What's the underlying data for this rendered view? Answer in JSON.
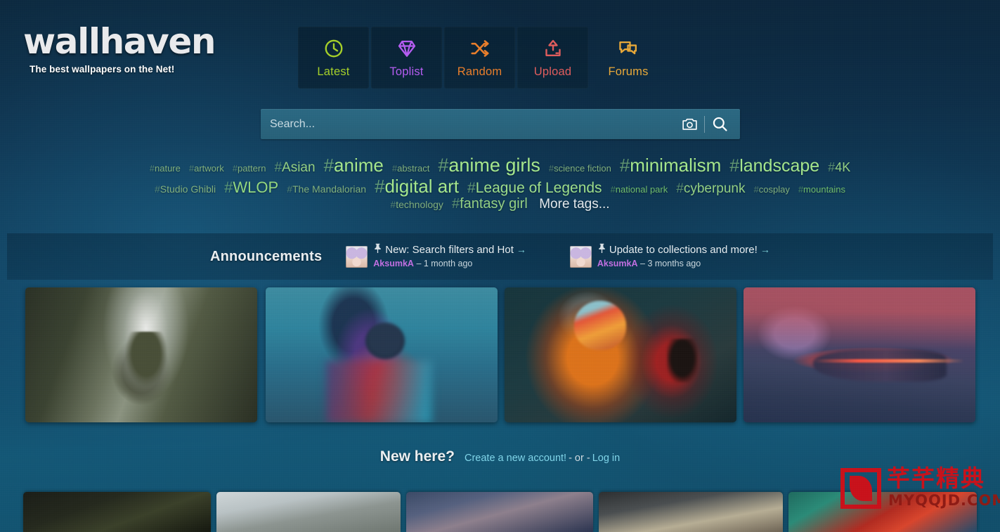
{
  "site": {
    "logo": "wallhaven",
    "tagline": "The best wallpapers on the Net!"
  },
  "nav": {
    "items": [
      {
        "label": "Latest",
        "icon": "clock-icon",
        "color": "#a5d028",
        "boxed": true
      },
      {
        "label": "Toplist",
        "icon": "diamond-icon",
        "color": "#b45cf0",
        "boxed": true
      },
      {
        "label": "Random",
        "icon": "shuffle-icon",
        "color": "#e87d2a",
        "boxed": true
      },
      {
        "label": "Upload",
        "icon": "upload-icon",
        "color": "#e05c5c",
        "boxed": true
      },
      {
        "label": "Forums",
        "icon": "chat-icon",
        "color": "#e8a838",
        "boxed": false
      }
    ]
  },
  "search": {
    "value": "",
    "placeholder": "Search...",
    "camera_icon": "camera-icon",
    "submit_icon": "magnifier-icon"
  },
  "tags": {
    "rows": [
      [
        {
          "label": "nature",
          "size": 13,
          "color": "#7fae7d"
        },
        {
          "label": "artwork",
          "size": 13,
          "color": "#7fae7d"
        },
        {
          "label": "pattern",
          "size": 13,
          "color": "#7fae7d"
        },
        {
          "label": "Asian",
          "size": 19,
          "color": "#93cf83"
        },
        {
          "label": "anime",
          "size": 26,
          "color": "#a4e68c"
        },
        {
          "label": "abstract",
          "size": 13,
          "color": "#7fae7d"
        },
        {
          "label": "anime girls",
          "size": 27,
          "color": "#a4e68c"
        },
        {
          "label": "science fiction",
          "size": 13,
          "color": "#7fae7d"
        },
        {
          "label": "minimalism",
          "size": 26,
          "color": "#a4e68c"
        },
        {
          "label": "landscape",
          "size": 25,
          "color": "#a4e68c"
        },
        {
          "label": "4K",
          "size": 18,
          "color": "#93cf83"
        }
      ],
      [
        {
          "label": "Studio Ghibli",
          "size": 14,
          "color": "#7fae7d"
        },
        {
          "label": "WLOP",
          "size": 22,
          "color": "#93d77f"
        },
        {
          "label": "The Mandalorian",
          "size": 14,
          "color": "#7fae7d"
        },
        {
          "label": "digital art",
          "size": 26,
          "color": "#a4e68c"
        },
        {
          "label": "League of Legends",
          "size": 21,
          "color": "#9ddd8a"
        },
        {
          "label": "national park",
          "size": 13,
          "color": "#6fbb6c"
        },
        {
          "label": "cyberpunk",
          "size": 19,
          "color": "#93cf83"
        },
        {
          "label": "cosplay",
          "size": 13,
          "color": "#7fae7d"
        },
        {
          "label": "mountains",
          "size": 13,
          "color": "#6fbb6c"
        }
      ],
      [
        {
          "label": "technology",
          "size": 14,
          "color": "#7fae7d"
        },
        {
          "label": "fantasy girl",
          "size": 20,
          "color": "#93cf83"
        }
      ]
    ],
    "more_label": "More tags..."
  },
  "announcements": {
    "heading": "Announcements",
    "items": [
      {
        "title": "New: Search filters and Hot",
        "author": "AksumkA",
        "dash": "–",
        "time": "1 month ago",
        "pin_icon": "pin-icon",
        "arrow_icon": "arrow-right-icon",
        "avatar": "user-avatar"
      },
      {
        "title": "Update to collections and more!",
        "author": "AksumkA",
        "dash": "–",
        "time": "3 months ago",
        "pin_icon": "pin-icon",
        "arrow_icon": "arrow-right-icon",
        "avatar": "user-avatar"
      }
    ]
  },
  "featured": {
    "items": [
      {
        "alt": "person falling through forest canopy"
      },
      {
        "alt": "blue teal painted portrait from behind"
      },
      {
        "alt": "astronaut with orange red paint splatter"
      },
      {
        "alt": "dragon over lake with red laser beam"
      }
    ]
  },
  "new_here": {
    "title": "New here?",
    "create_label": "Create a new account!",
    "separator": "- or -",
    "login_label": "Log in"
  },
  "bottom_thumbs": {
    "items": [
      {
        "alt": "dark mountain landscape"
      },
      {
        "alt": "snowy stone arches ruins"
      },
      {
        "alt": "purple blue sky scenery"
      },
      {
        "alt": "spaceship cockpit interior"
      },
      {
        "alt": "red and teal creature artwork"
      }
    ]
  },
  "watermark": {
    "chinese": "芊芊精典",
    "english": "MYQQJD.COM",
    "color": "#c8111a"
  }
}
